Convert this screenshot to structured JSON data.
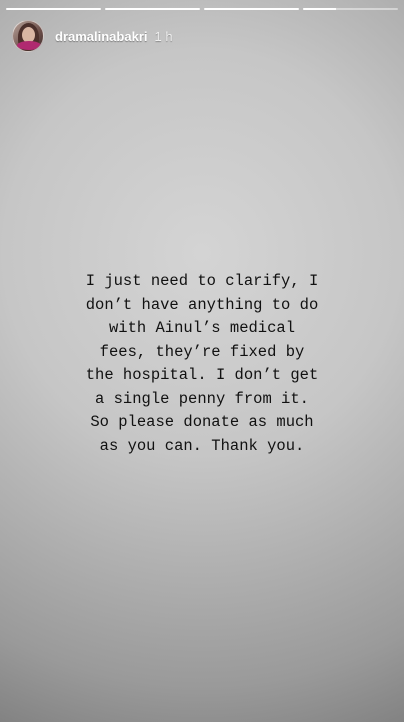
{
  "story": {
    "progress": [
      1,
      1,
      1,
      0.35
    ],
    "user": {
      "username": "dramalinabakri",
      "timestamp": "1 h"
    },
    "message_lines": [
      "I just need to clarify, I",
      "don’t have anything to do",
      "with Ainul’s medical",
      "fees, they’re fixed by",
      "the hospital. I don’t get",
      "a single penny from it.",
      "So please donate as much",
      "as you can. Thank you."
    ]
  }
}
